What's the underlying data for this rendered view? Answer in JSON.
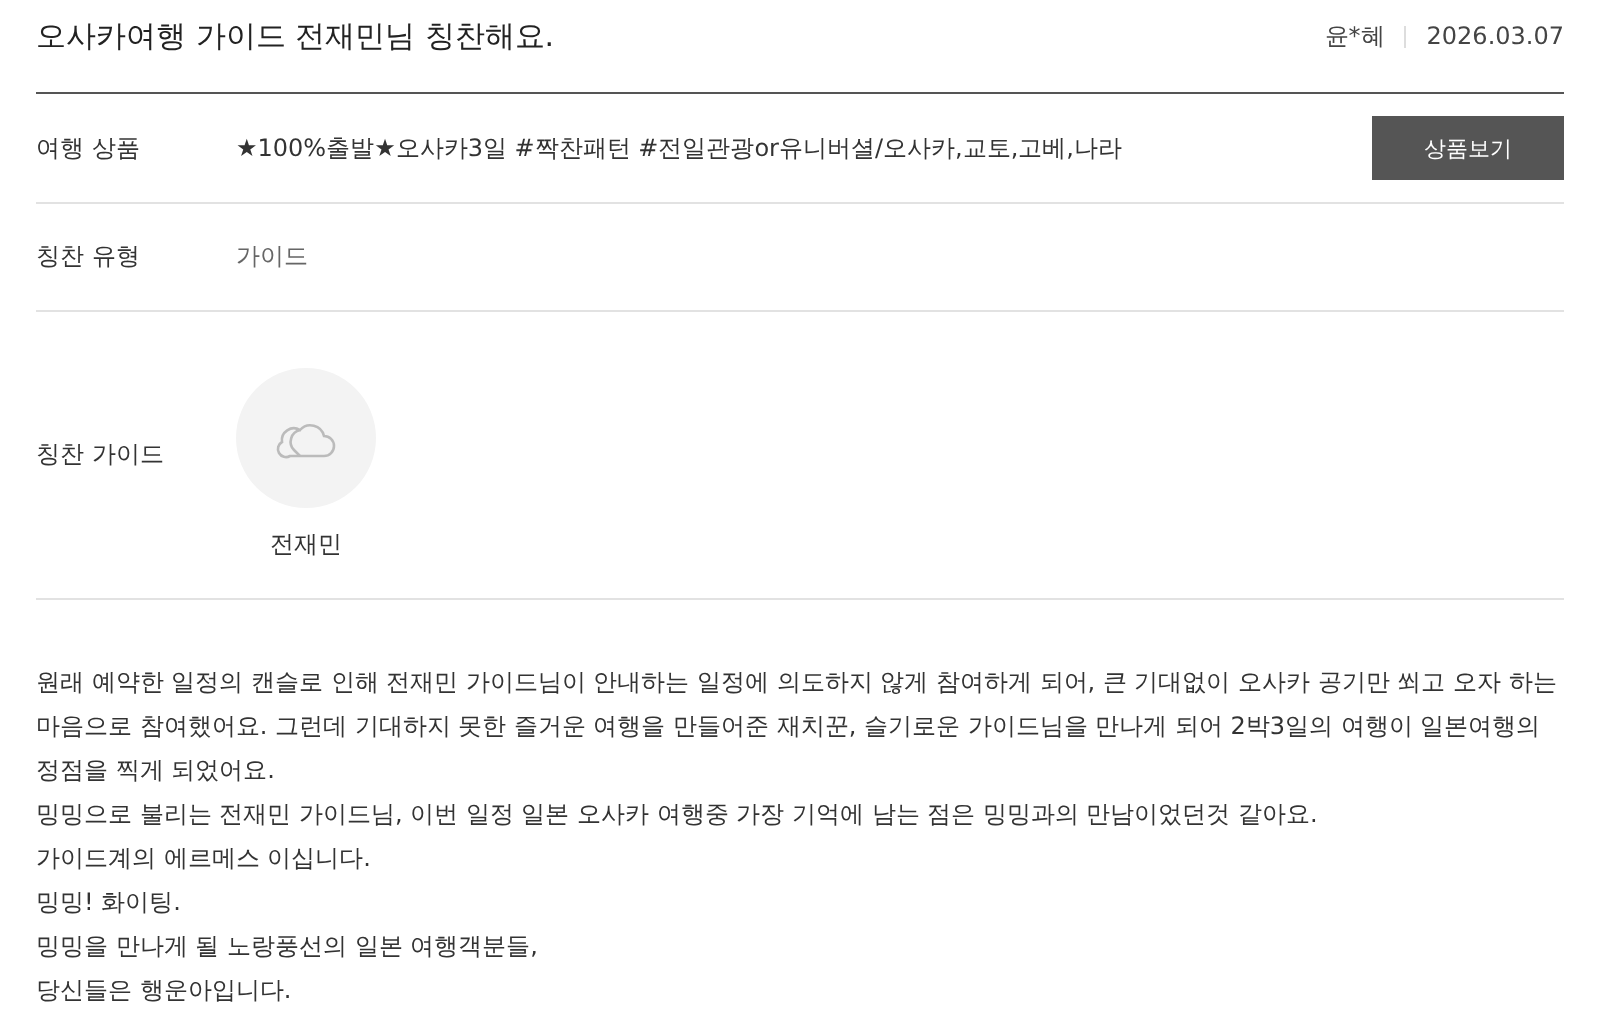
{
  "title": "오사카여행 가이드 전재민님 칭찬해요.",
  "author": "윤*혜",
  "date": "2026.03.07",
  "rows": [
    {
      "kind": "product",
      "label": "여행 상품",
      "value": "★100%출발★오사카3일 #짝찬패턴 #전일관광or유니버셜/오사카,교토,고베,나라",
      "button": "상품보기"
    },
    {
      "kind": "text",
      "label": "칭찬 유형",
      "value": "가이드"
    },
    {
      "kind": "guide",
      "label": "칭찬 가이드",
      "name": "전재민"
    }
  ],
  "body": [
    "원래 예약한 일정의 캔슬로 인해 전재민 가이드님이 안내하는 일정에 의도하지 않게 참여하게 되어, 큰 기대없이 오사카 공기만 쐬고 오자 하는 마음으로 참여했어요. 그런데 기대하지 못한 즐거운 여행을 만들어준 재치꾼, 슬기로운 가이드님을 만나게 되어 2박3일의 여행이 일본여행의 정점을 찍게 되었어요.",
    "밍밍으로 불리는 전재민 가이드님, 이번 일정 일본 오사카 여행중 가장 기억에 남는 점은 밍밍과의 만남이었던것 같아요.",
    "가이드계의 에르메스 이십니다.",
    "밍밍! 화이팅.",
    "밍밍을 만나게 될 노랑풍선의 일본 여행객분들,",
    "당신들은 행운아입니다."
  ]
}
